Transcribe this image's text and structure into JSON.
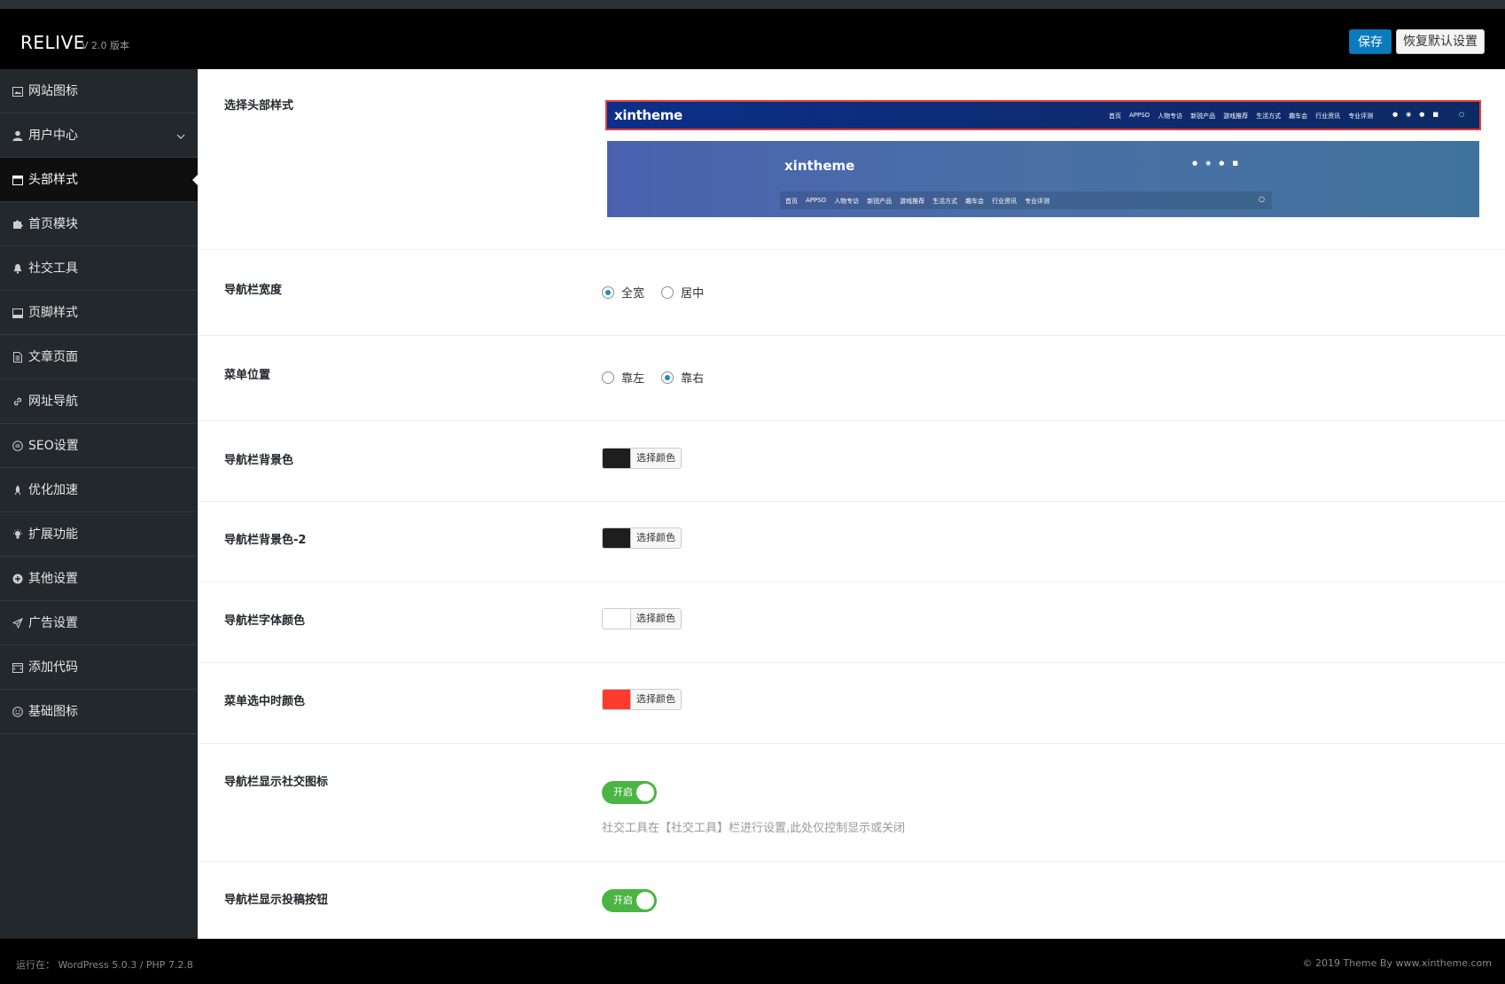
{
  "app": {
    "name": "RELIVE",
    "version": "V 2.0 版本"
  },
  "toolbar": {
    "save_label": "保存",
    "reset_label": "恢复默认设置"
  },
  "sidebar": {
    "items": [
      {
        "label": "网站图标",
        "icon": "image-icon"
      },
      {
        "label": "用户中心",
        "icon": "user-icon",
        "expandable": true
      },
      {
        "label": "头部样式",
        "icon": "layout-icon",
        "active": true
      },
      {
        "label": "首页模块",
        "icon": "puzzle-icon"
      },
      {
        "label": "社交工具",
        "icon": "bell-icon"
      },
      {
        "label": "页脚样式",
        "icon": "footer-icon"
      },
      {
        "label": "文章页面",
        "icon": "document-icon"
      },
      {
        "label": "网址导航",
        "icon": "link-icon"
      },
      {
        "label": "SEO设置",
        "icon": "seo-icon"
      },
      {
        "label": "优化加速",
        "icon": "rocket-icon"
      },
      {
        "label": "扩展功能",
        "icon": "bulb-icon"
      },
      {
        "label": "其他设置",
        "icon": "plus-circle-icon"
      },
      {
        "label": "广告设置",
        "icon": "send-icon"
      },
      {
        "label": "添加代码",
        "icon": "code-icon"
      },
      {
        "label": "基础图标",
        "icon": "smile-icon"
      }
    ]
  },
  "settings": {
    "header_style": {
      "title": "选择头部样式",
      "preview1": {
        "logo": "xintheme",
        "menu": [
          "首页",
          "APPSO",
          "人物专访",
          "新锐产品",
          "游戏推荐",
          "生活方式",
          "趣车会",
          "行业资讯",
          "专业评测"
        ],
        "selected": true
      },
      "preview2": {
        "logo": "xintheme",
        "menu": [
          "首页",
          "APPSO",
          "人物专访",
          "新锐产品",
          "游戏推荐",
          "生活方式",
          "趣车会",
          "行业资讯",
          "专业评测"
        ]
      }
    },
    "nav_width": {
      "title": "导航栏宽度",
      "options": [
        "全宽",
        "居中"
      ],
      "selected": "全宽"
    },
    "menu_position": {
      "title": "菜单位置",
      "options": [
        "靠左",
        "靠右"
      ],
      "selected": "靠右"
    },
    "nav_bg": {
      "title": "导航栏背景色",
      "button": "选择颜色",
      "color": "#1e1e1e"
    },
    "nav_bg2": {
      "title": "导航栏背景色-2",
      "button": "选择颜色",
      "color": "#1e1e1e"
    },
    "nav_font": {
      "title": "导航栏字体颜色",
      "button": "选择颜色",
      "color": "#ffffff"
    },
    "menu_active": {
      "title": "菜单选中时颜色",
      "button": "选择颜色",
      "color": "#ff3b30"
    },
    "show_social": {
      "title": "导航栏显示社交图标",
      "toggle": "开启",
      "help": "社交工具在【社交工具】栏进行设置,此处仅控制显示或关闭"
    },
    "show_submit": {
      "title": "导航栏显示投稿按钮",
      "toggle": "开启"
    }
  },
  "footer": {
    "left": "运行在：  WordPress 5.0.3 / PHP 7.2.8",
    "right": "© 2019 Theme By www.xintheme.com"
  },
  "colors": {
    "accent": "#0a7bbd",
    "toggle_on": "#4bb543",
    "sidebar_bg": "#23282d"
  }
}
